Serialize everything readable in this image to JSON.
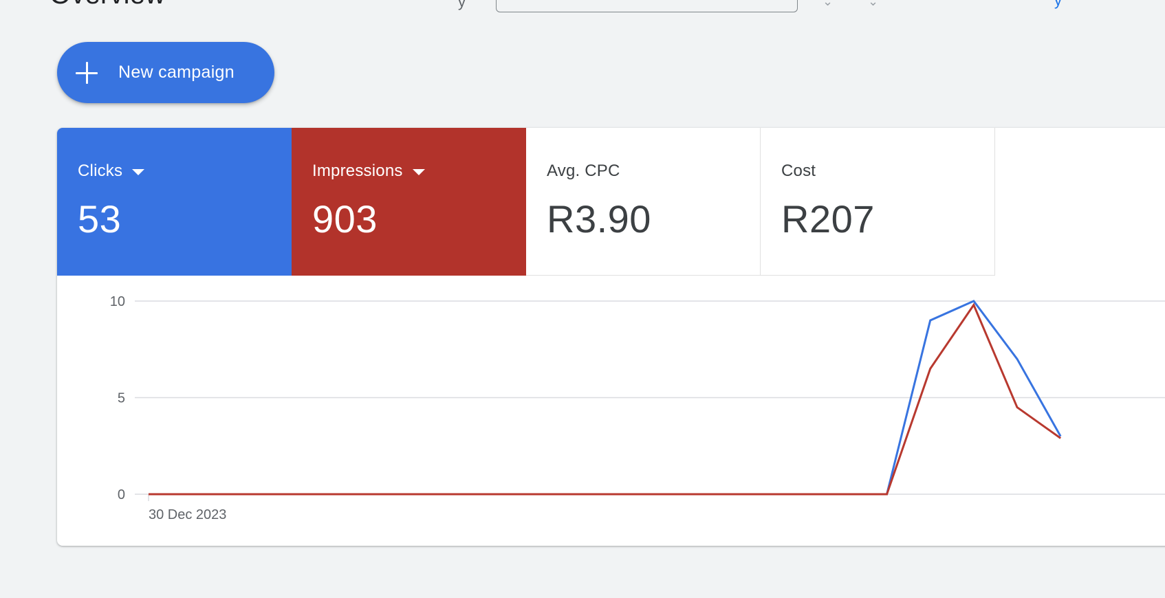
{
  "header": {
    "title": "Overview",
    "label_fragment": "y",
    "glyphs": [
      "⌄",
      "⌄"
    ],
    "link_fragment": "y"
  },
  "actions": {
    "new_campaign_label": "New campaign",
    "new_campaign_icon": "plus-icon"
  },
  "metrics": [
    {
      "label": "Clicks",
      "value": "53",
      "has_dropdown": true,
      "color": "#3873e1"
    },
    {
      "label": "Impressions",
      "value": "903",
      "has_dropdown": true,
      "color": "#b2332b"
    },
    {
      "label": "Avg. CPC",
      "value": "R3.90",
      "has_dropdown": false,
      "color": "#ffffff"
    },
    {
      "label": "Cost",
      "value": "R207",
      "has_dropdown": false,
      "color": "#ffffff"
    }
  ],
  "chart_data": {
    "type": "line",
    "ylim": [
      0,
      10
    ],
    "yticks": [
      "10",
      "5",
      "0"
    ],
    "xtick_label": "30 Dec 2023",
    "grid": true,
    "legend": "none",
    "x": [
      0,
      1,
      2,
      3,
      4,
      5,
      6,
      7,
      8,
      9,
      10,
      11,
      12,
      13,
      14,
      15,
      16,
      17,
      18,
      19,
      20,
      21
    ],
    "series": [
      {
        "color": "#3874e0",
        "values": [
          0,
          0,
          0,
          0,
          0,
          0,
          0,
          0,
          0,
          0,
          0,
          0,
          0,
          0,
          0,
          0,
          0,
          0,
          9,
          10,
          7,
          3
        ]
      },
      {
        "color": "#b8392f",
        "values": [
          0,
          0,
          0,
          0,
          0,
          0,
          0,
          0,
          0,
          0,
          0,
          0,
          0,
          0,
          0,
          0,
          0,
          0,
          6.5,
          9.8,
          4.5,
          2.9
        ]
      }
    ]
  }
}
